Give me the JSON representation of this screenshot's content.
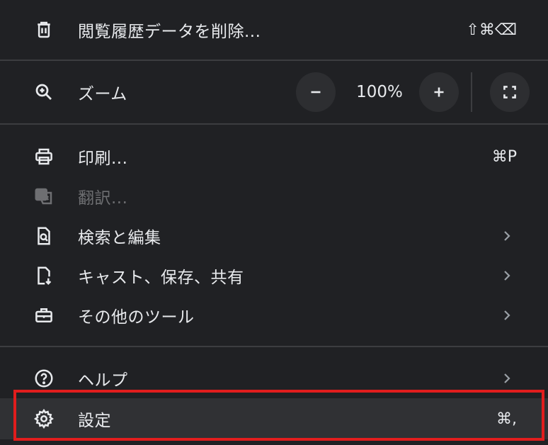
{
  "menu": {
    "clear_data": {
      "label": "閲覧履歴データを削除...",
      "shortcut": "⇧⌘⌫",
      "icon": "trash-icon"
    },
    "zoom": {
      "label": "ズーム",
      "value": "100%",
      "icon": "zoom-icon",
      "decrease_icon": "minus-icon",
      "increase_icon": "plus-icon",
      "fullscreen_icon": "fullscreen-icon"
    },
    "print": {
      "label": "印刷...",
      "shortcut": "⌘P",
      "icon": "printer-icon"
    },
    "translate": {
      "label": "翻訳...",
      "icon": "translate-icon",
      "disabled": true
    },
    "find_edit": {
      "label": "検索と編集",
      "icon": "find-page-icon"
    },
    "cast_save_share": {
      "label": "キャスト、保存、共有",
      "icon": "save-page-icon"
    },
    "more_tools": {
      "label": "その他のツール",
      "icon": "toolbox-icon"
    },
    "help": {
      "label": "ヘルプ",
      "icon": "help-icon"
    },
    "settings": {
      "label": "設定",
      "shortcut": "⌘,",
      "icon": "gear-icon",
      "highlighted": true
    }
  },
  "colors": {
    "background": "#202124",
    "text": "#e8eaed",
    "disabled_text": "#6e6f72",
    "highlight": "#303134",
    "annotation_box": "#e11d1d"
  }
}
